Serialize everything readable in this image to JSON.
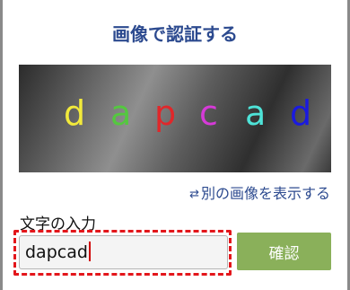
{
  "dialog": {
    "title": "画像で認証する",
    "captcha": {
      "characters": [
        {
          "char": "d",
          "color": "#f2ea3b"
        },
        {
          "char": "a",
          "color": "#54c83f"
        },
        {
          "char": "p",
          "color": "#e0272a"
        },
        {
          "char": "c",
          "color": "#d63ad8"
        },
        {
          "char": "a",
          "color": "#4ee3d8"
        },
        {
          "char": "d",
          "color": "#1a1ae0"
        }
      ]
    },
    "refresh_icon": "refresh-icon",
    "refresh_label": "別の画像を表示する",
    "input_label": "文字の入力",
    "input_value": "dapcad",
    "confirm_label": "確認"
  },
  "colors": {
    "title": "#2c4a8f",
    "link": "#2c4a8f",
    "confirm_button": "#8ab05a",
    "highlight": "#e3161b"
  }
}
